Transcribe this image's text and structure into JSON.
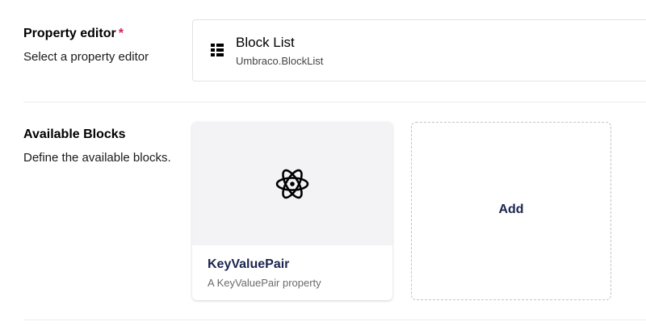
{
  "property_editor": {
    "label": "Property editor",
    "required_mark": "*",
    "description": "Select a property editor",
    "selected": {
      "name": "Block List",
      "alias": "Umbraco.BlockList",
      "icon": "block-list-icon"
    }
  },
  "available_blocks": {
    "label": "Available Blocks",
    "description": "Define the available blocks.",
    "blocks": [
      {
        "title": "KeyValuePair",
        "description": "A KeyValuePair property",
        "icon": "atom-icon"
      }
    ],
    "add_label": "Add"
  },
  "colors": {
    "accent_text": "#1b264f",
    "required": "#d42054",
    "card_preview_bg": "#f3f3f5"
  }
}
